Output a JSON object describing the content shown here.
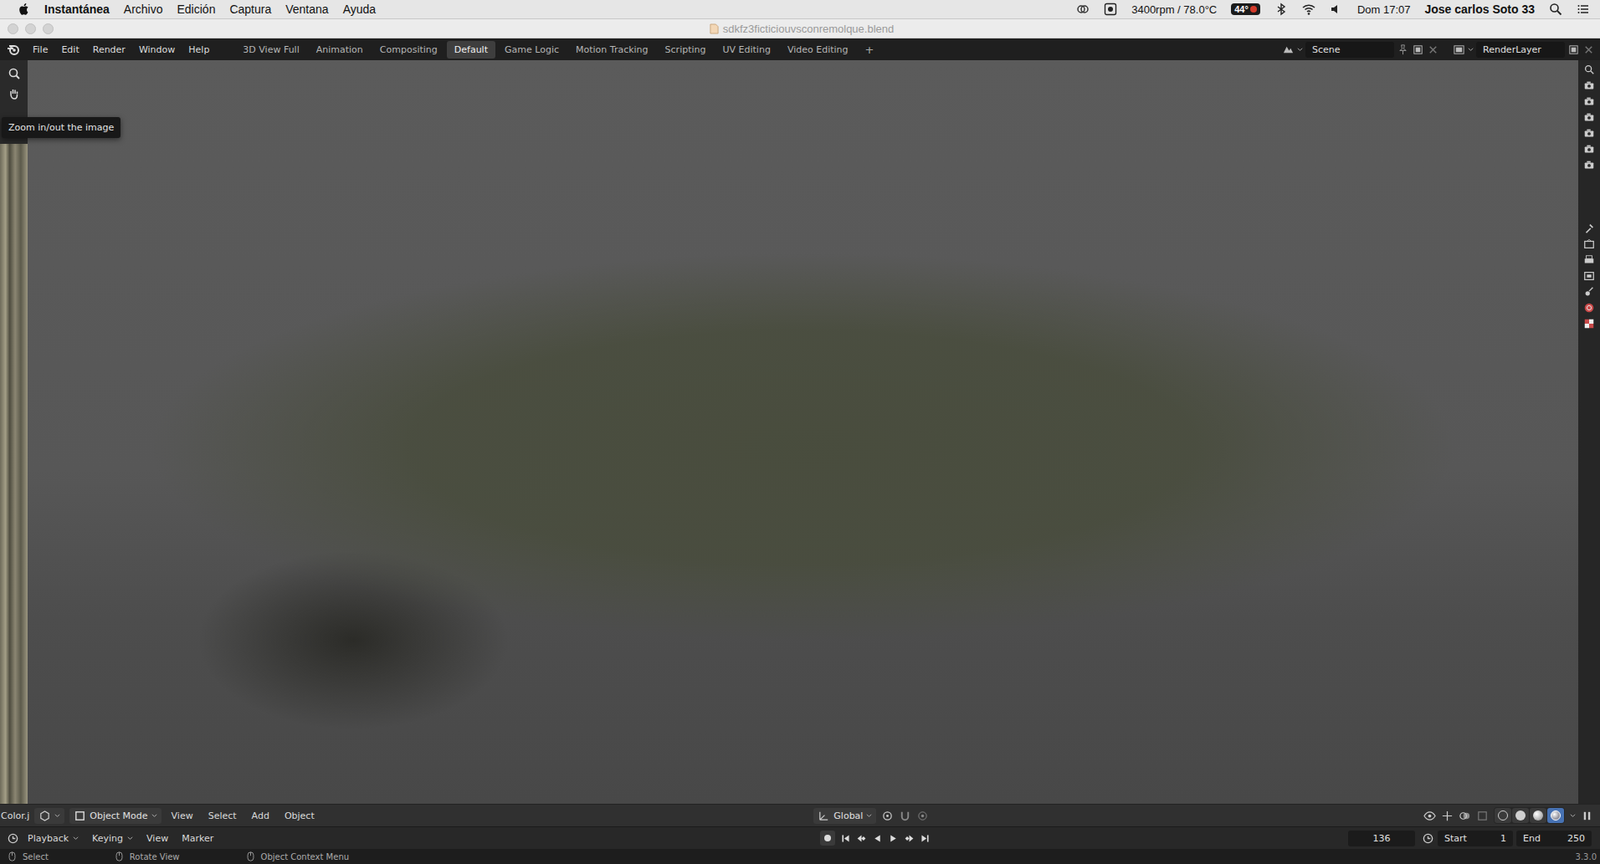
{
  "mac_menubar": {
    "app": "Instantánea",
    "menus": [
      "Archivo",
      "Edición",
      "Captura",
      "Ventana",
      "Ayuda"
    ],
    "fan": "3400rpm / 78.0°C",
    "battery_temp": "44°",
    "clock": "Dom 17:07",
    "user": "Jose carlos Soto 33"
  },
  "window": {
    "title": "sdkfz3ficticiouvsconremolque.blend"
  },
  "blender_menu": [
    "File",
    "Edit",
    "Render",
    "Window",
    "Help"
  ],
  "workspaces": [
    {
      "label": "3D View Full",
      "selected": false
    },
    {
      "label": "Animation",
      "selected": false
    },
    {
      "label": "Compositing",
      "selected": false
    },
    {
      "label": "Default",
      "selected": true
    },
    {
      "label": "Game Logic",
      "selected": false
    },
    {
      "label": "Motion Tracking",
      "selected": false
    },
    {
      "label": "Scripting",
      "selected": false
    },
    {
      "label": "UV Editing",
      "selected": false
    },
    {
      "label": "Video Editing",
      "selected": false
    }
  ],
  "add_workspace": "+",
  "scene": "Scene",
  "render_layer": "RenderLayer",
  "tooltip": "Zoom in/out the image",
  "viewport_header": {
    "left_cut": "Color.j",
    "mode": "Object Mode",
    "menus": [
      "View",
      "Select",
      "Add",
      "Object"
    ],
    "orientation": "Global",
    "shading": [
      {
        "selected": false
      },
      {
        "selected": false
      },
      {
        "selected": false
      },
      {
        "selected": true
      }
    ]
  },
  "timeline": {
    "menus": [
      "Playback",
      "Keying",
      "View",
      "Marker"
    ],
    "frame": "136",
    "start_label": "Start",
    "start": "1",
    "end_label": "End",
    "end": "250"
  },
  "status_bar": {
    "items": [
      "Select",
      "Rotate View",
      "Object Context Menu"
    ],
    "version": "3.3.0"
  }
}
